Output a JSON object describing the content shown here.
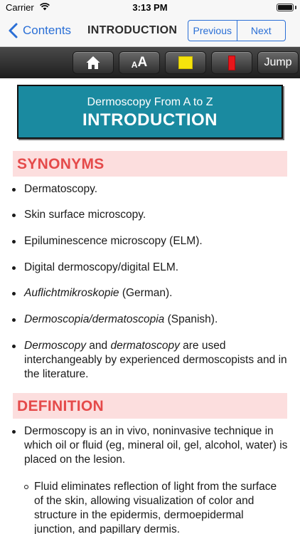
{
  "status_bar": {
    "carrier": "Carrier",
    "time": "3:13 PM"
  },
  "nav": {
    "back_label": "Contents",
    "title": "INTRODUCTION",
    "previous_label": "Previous",
    "next_label": "Next",
    "accent_color": "#2a6fd6"
  },
  "toolbar": {
    "home_icon": "home-icon",
    "font_small": "A",
    "font_big": "A",
    "note_icon": "sticky-note-icon",
    "bookmark_icon": "bookmark-icon",
    "jump_label": "Jump"
  },
  "banner": {
    "subtitle": "Dermoscopy From A to Z",
    "title": "INTRODUCTION",
    "color": "#1a8aa0"
  },
  "synonyms": {
    "heading": "SYNONYMS",
    "items": [
      "Dermatoscopy.",
      "Skin surface microscopy.",
      "Epiluminescence microscopy (ELM).",
      "Digital dermoscopy/digital ELM."
    ],
    "item5_italic": "Auflichtmikroskopie",
    "item5_rest": " (German).",
    "item6_italic": "Dermoscopia/dermatoscopia",
    "item6_rest": " (Spanish).",
    "item7_italic1": "Dermoscopy",
    "item7_and": " and ",
    "item7_italic2": "dermatoscopy",
    "item7_rest": " are used interchangeably by experienced dermoscopists and in the literature."
  },
  "definition": {
    "heading": "DEFINITION",
    "item1": "Dermoscopy is an in vivo, noninvasive technique in which oil or fluid (eg, mineral oil, gel, alcohol, water) is placed on the lesion.",
    "sub1": "Fluid eliminates reflection of light from the surface of the skin, allowing visualization of color and structure in the epidermis, dermoepidermal junction, and papillary dermis."
  }
}
